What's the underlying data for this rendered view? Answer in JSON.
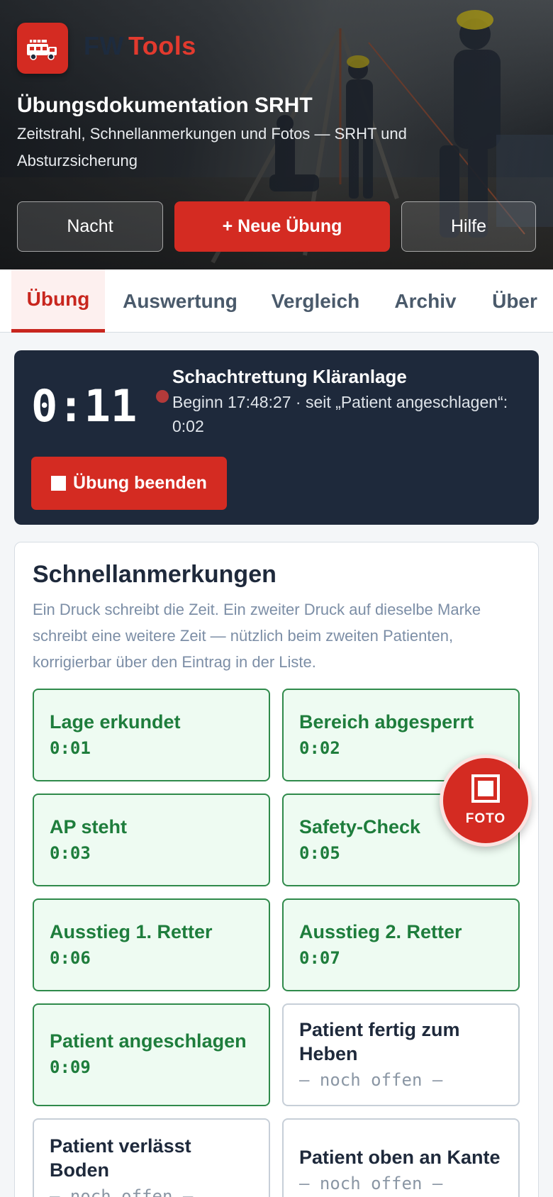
{
  "header": {
    "brand_fw": "FW",
    "brand_tools": "Tools",
    "title": "Übungsdokumentation SRHT",
    "subtitle": "Zeitstrahl, Schnellanmerkungen und Fotos — SRHT und Absturzsicherung",
    "buttons": {
      "night": "Nacht",
      "new": "+ Neue Übung",
      "help": "Hilfe"
    }
  },
  "tabs": [
    {
      "label": "Übung",
      "active": true
    },
    {
      "label": "Auswertung"
    },
    {
      "label": "Vergleich"
    },
    {
      "label": "Archiv"
    },
    {
      "label": "Über"
    }
  ],
  "exercise": {
    "elapsed": "0:11",
    "name": "Schachtrettung Kläranlage",
    "meta": "Beginn 17:48:27 · seit „Patient angeschlagen“: 0:02",
    "stop_label": "Übung beenden"
  },
  "quicknotes": {
    "title": "Schnellanmerkungen",
    "description": "Ein Druck schreibt die Zeit. Ein zweiter Druck auf dieselbe Marke schreibt eine weitere Zeit — nützlich beim zweiten Patienten, korrigierbar über den Eintrag in der Liste.",
    "items": [
      {
        "label": "Lage erkundet",
        "time": "0:01",
        "done": true
      },
      {
        "label": "Bereich abgesperrt",
        "time": "0:02",
        "done": true
      },
      {
        "label": "AP steht",
        "time": "0:03",
        "done": true
      },
      {
        "label": "Safety-Check",
        "time": "0:05",
        "done": true
      },
      {
        "label": "Ausstieg 1. Retter",
        "time": "0:06",
        "done": true
      },
      {
        "label": "Ausstieg 2. Retter",
        "time": "0:07",
        "done": true
      },
      {
        "label": "Patient angeschlagen",
        "time": "0:09",
        "done": true
      },
      {
        "label": "Patient fertig zum Heben",
        "time": "— noch offen —",
        "done": false
      },
      {
        "label": "Patient verlässt Boden",
        "time": "— noch offen —",
        "done": false
      },
      {
        "label": "Patient oben an Kante",
        "time": "— noch offen —",
        "done": false
      }
    ]
  },
  "fab": {
    "label": "FOTO",
    "icon": "camera-icon"
  },
  "colors": {
    "accent": "#d42b22",
    "done": "#1e7d3c",
    "dark": "#1e293b"
  }
}
